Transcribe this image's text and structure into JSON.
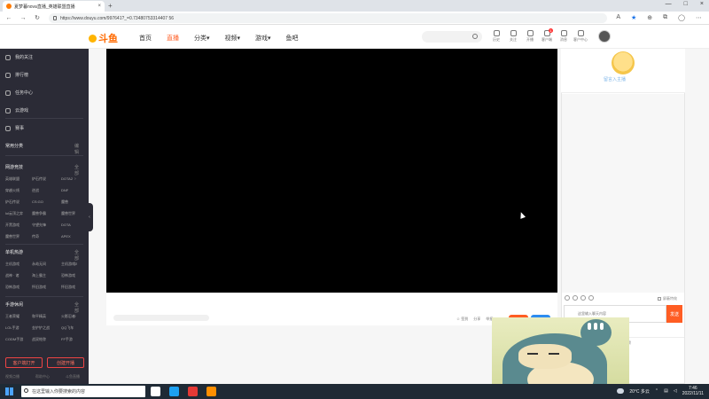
{
  "browser": {
    "tab_title": "夏梦暮nova直播_英雄联盟直播",
    "tab_close": "×",
    "new_tab": "+",
    "window_controls": [
      "—",
      "□",
      "×"
    ],
    "nav": {
      "back": "←",
      "forward": "→",
      "refresh": "↻"
    },
    "url": "https://www.douyu.com/997641?_=0.73480753314407 56",
    "right_icons": [
      "A",
      "★",
      "⊕",
      "⧉",
      "◯",
      "⋯"
    ]
  },
  "site": {
    "logo_text": "斗鱼",
    "nav": [
      "首页",
      "直播",
      "分类▾",
      "视频▾",
      "游戏▾",
      "鱼吧"
    ],
    "active_nav_index": 1,
    "accent_color": "#ff5d23",
    "header_icons": [
      {
        "label": "历史",
        "badge": ""
      },
      {
        "label": "关注",
        "badge": ""
      },
      {
        "label": "开播",
        "badge": ""
      },
      {
        "label": "客户端",
        "badge": "1"
      },
      {
        "label": "消息",
        "badge": ""
      },
      {
        "label": "客户中心",
        "badge": ""
      }
    ]
  },
  "sidebar": {
    "items": [
      "我的关注",
      "排行榜",
      "任务中心",
      "云游戏"
    ],
    "hot": {
      "label": "赛事"
    },
    "sections": [
      {
        "title": "常用分类",
        "more": "编辑"
      },
      {
        "title": "网游竞技",
        "more": "全部 ›",
        "grid": [
          "英雄联盟",
          "炉石传说",
          "DOTA2",
          "穿越火线",
          "逆战",
          "DNF",
          "炉石传说",
          "CS:GO",
          "魔兽",
          "lol云顶之弈",
          "魔兽争霸",
          "魔兽世界",
          "开黑游戏",
          "守望先锋",
          "DOTA",
          "魔兽世界",
          "传奇",
          "APEX"
        ]
      },
      {
        "title": "单机热游",
        "more": "全部 ›",
        "grid": [
          "主机游戏",
          "永劫无间",
          "主机游戏2",
          "战神 · 诸",
          "海上霸主",
          "恐怖游戏",
          "恐怖游戏",
          "怀旧游戏",
          "怀旧游戏"
        ]
      },
      {
        "title": "手游休闲",
        "more": "全部 ›",
        "grid": [
          "王者荣耀",
          "和平精英",
          "火影忍者",
          "LOL手游",
          "金铲铲之战",
          "QQ飞车",
          "CODM手游",
          "战双帕弥",
          "FF手游"
        ]
      }
    ],
    "buttons": [
      "客户端打开",
      "创建开播"
    ],
    "footer": [
      "视频点播",
      "帮助中心",
      "斗鱼直播"
    ],
    "collapse_glyph": "‹"
  },
  "player": {
    "footer_items": [
      "☺ 签到",
      "分享",
      "举报"
    ]
  },
  "chat": {
    "mascot_caption": "留言入主播",
    "block_label": "屏蔽特效",
    "input_placeholder": "这里输入聊天内容",
    "send_label": "发送",
    "lower_label": "贡献榜"
  },
  "taskbar": {
    "search_placeholder": "在这里输入你要搜索的内容",
    "weather": "20°C 多云",
    "time": "7:46",
    "date": "2022/11/11",
    "pinned_colors": [
      "#ffffff",
      "#1da1f2",
      "#e53935",
      "#ff8f00"
    ]
  }
}
